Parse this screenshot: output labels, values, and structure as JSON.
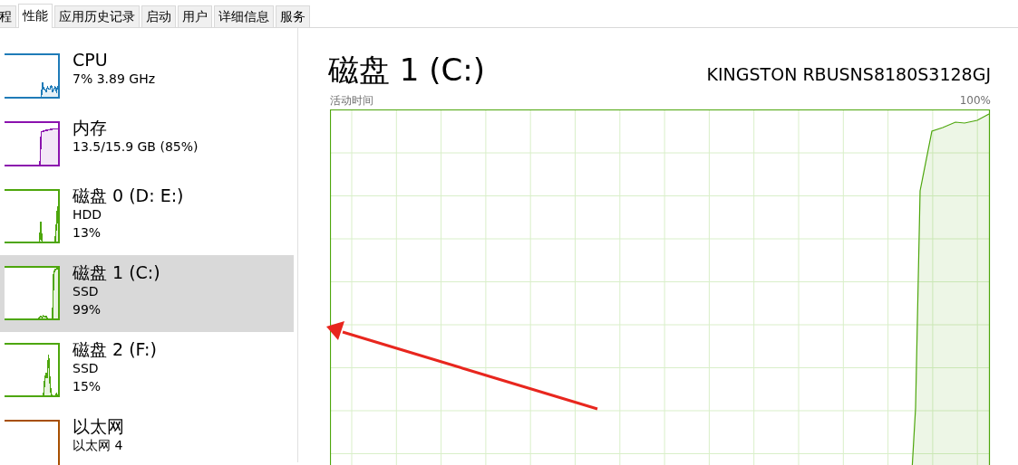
{
  "tabs": [
    {
      "label": "程",
      "selected": false
    },
    {
      "label": "性能",
      "selected": true
    },
    {
      "label": "应用历史记录",
      "selected": false
    },
    {
      "label": "启动",
      "selected": false
    },
    {
      "label": "用户",
      "selected": false
    },
    {
      "label": "详细信息",
      "selected": false
    },
    {
      "label": "服务",
      "selected": false
    }
  ],
  "sidebar": {
    "items": [
      {
        "kind": "cpu",
        "name": "CPU",
        "lines": [
          "7% 3.89 GHz"
        ],
        "color": "#1f7bb8",
        "selected": false
      },
      {
        "kind": "memory",
        "name": "内存",
        "lines": [
          "13.5/15.9 GB (85%)"
        ],
        "color": "#8b12ae",
        "selected": false
      },
      {
        "kind": "disk",
        "name": "磁盘 0 (D: E:)",
        "lines": [
          "HDD",
          "13%"
        ],
        "color": "#4da60c",
        "selected": false
      },
      {
        "kind": "disk",
        "name": "磁盘 1 (C:)",
        "lines": [
          "SSD",
          "99%"
        ],
        "color": "#4da60c",
        "selected": true
      },
      {
        "kind": "disk",
        "name": "磁盘 2 (F:)",
        "lines": [
          "SSD",
          "15%"
        ],
        "color": "#4da60c",
        "selected": false
      },
      {
        "kind": "network",
        "name": "以太网",
        "lines": [
          "以太网 4"
        ],
        "color": "#a74f01",
        "selected": false
      }
    ]
  },
  "detail": {
    "title": "磁盘 1 (C:)",
    "model": "KINGSTON RBUSNS8180S3128GJ",
    "chart_label": "活动时间",
    "chart_max": "100%"
  }
}
